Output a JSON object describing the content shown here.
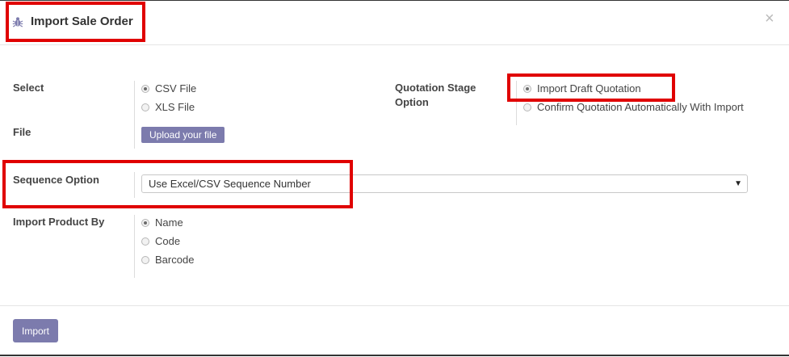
{
  "dialog": {
    "title": "Import Sale Order",
    "close_symbol": "×",
    "icon": "bug-icon"
  },
  "form": {
    "select_label": "Select",
    "file_type_options": [
      {
        "label": "CSV File",
        "selected": true
      },
      {
        "label": "XLS File",
        "selected": false
      }
    ],
    "file_label": "File",
    "upload_label": "Upload your file",
    "quotation_stage_label": "Quotation Stage",
    "quotation_stage_label_2": "Option",
    "stage_options": [
      {
        "label": "Import Draft Quotation",
        "selected": true
      },
      {
        "label": "Confirm Quotation Automatically With Import",
        "selected": false
      }
    ],
    "sequence_label": "Sequence Option",
    "sequence_value": "Use Excel/CSV Sequence Number",
    "import_by_label": "Import Product By",
    "import_by_options": [
      {
        "label": "Name",
        "selected": true
      },
      {
        "label": "Code",
        "selected": false
      },
      {
        "label": "Barcode",
        "selected": false
      }
    ]
  },
  "footer": {
    "import_label": "Import"
  },
  "colors": {
    "accent": "#7c7bad",
    "highlight": "#e00000"
  }
}
